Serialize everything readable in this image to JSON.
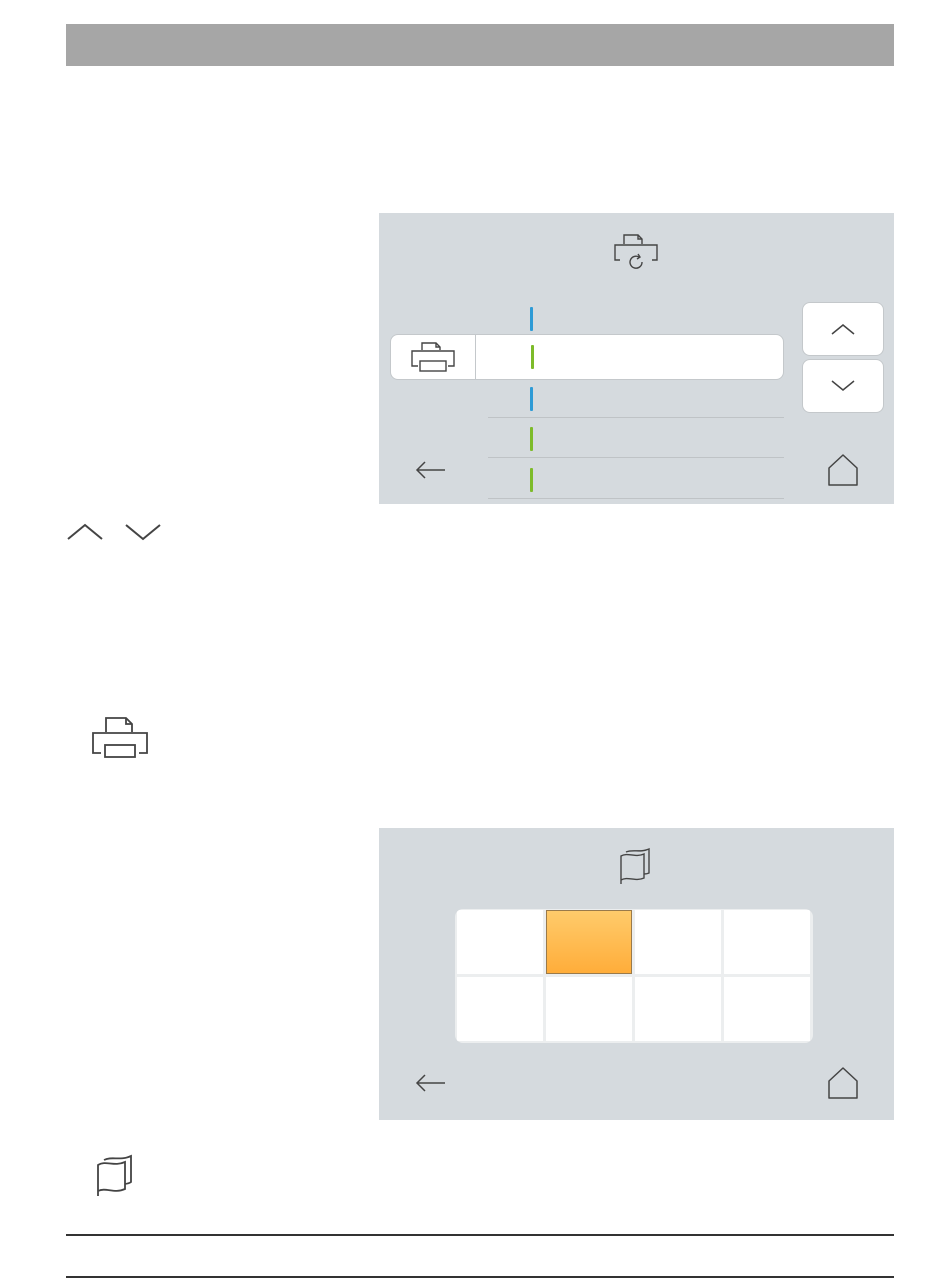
{
  "header": {
    "title": ""
  },
  "panel1": {
    "title_icon": "printer-refresh-icon",
    "selected_row_icon": "printer-icon",
    "rows": [
      {
        "text": "",
        "color": "#2e9bd6"
      },
      {
        "text": "",
        "color": "#7dbb2a"
      },
      {
        "text": "",
        "color": "#2e9bd6"
      },
      {
        "text": "",
        "color": "#7dbb2a"
      },
      {
        "text": "",
        "color": "#7dbb2a"
      }
    ],
    "scroll_up_icon": "chevron-up-icon",
    "scroll_down_icon": "chevron-down-icon",
    "back_icon": "arrow-left-icon",
    "home_icon": "home-icon"
  },
  "legend1": {
    "icons": [
      "chevron-up-icon",
      "chevron-down-icon"
    ]
  },
  "legend2": {
    "icon": "printer-icon"
  },
  "panel2": {
    "title_icon": "flag-icon",
    "grid": {
      "rows": 2,
      "cols": 4,
      "selected_index": 1
    },
    "selected_color": "#ffb94a",
    "back_icon": "arrow-left-icon",
    "home_icon": "home-icon"
  },
  "legend3": {
    "icon": "flag-icon"
  }
}
